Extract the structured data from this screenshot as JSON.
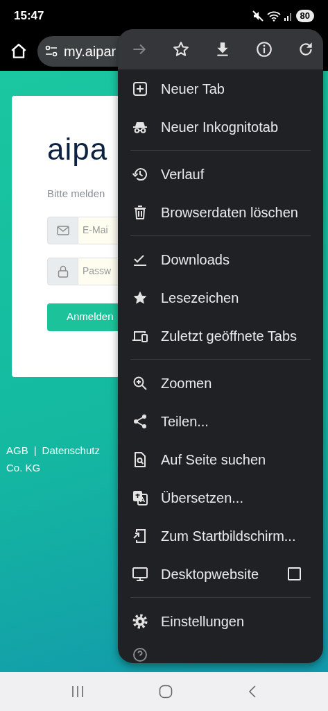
{
  "status_bar": {
    "time": "15:47",
    "battery": "80"
  },
  "toolbar": {
    "url": "my.aipar"
  },
  "page": {
    "logo": "aipa",
    "prompt": "Bitte melden",
    "email_placeholder": "E-Mai",
    "password_placeholder": "Passw",
    "submit": "Anmelden",
    "footer_links": [
      "AGB",
      "Datenschutz"
    ],
    "separator": "|",
    "footer_text": "Co. KG"
  },
  "menu": {
    "top_icons": [
      {
        "disabled": true
      },
      {
        "disabled": false
      },
      {
        "disabled": false
      },
      {
        "disabled": false
      },
      {
        "disabled": false
      }
    ],
    "sections": [
      {
        "items": [
          {
            "kind": "action",
            "label": "Neuer Tab"
          },
          {
            "kind": "action",
            "label": "Neuer Inkognitotab"
          }
        ]
      },
      {
        "items": [
          {
            "kind": "action",
            "label": "Verlauf"
          },
          {
            "kind": "action",
            "label": "Browserdaten löschen"
          }
        ]
      },
      {
        "items": [
          {
            "kind": "action",
            "label": "Downloads"
          },
          {
            "kind": "action",
            "label": "Lesezeichen"
          },
          {
            "kind": "action",
            "label": "Zuletzt geöffnete Tabs"
          }
        ]
      },
      {
        "items": [
          {
            "kind": "action",
            "label": "Zoomen"
          },
          {
            "kind": "action",
            "label": "Teilen..."
          },
          {
            "kind": "action",
            "label": "Auf Seite suchen"
          },
          {
            "kind": "action",
            "label": "Übersetzen..."
          },
          {
            "kind": "action",
            "label": "Zum Startbildschirm..."
          },
          {
            "kind": "checkbox",
            "label": "Desktopwebsite",
            "checked": false
          }
        ]
      },
      {
        "items": [
          {
            "kind": "action",
            "label": "Einstellungen"
          }
        ]
      }
    ]
  }
}
